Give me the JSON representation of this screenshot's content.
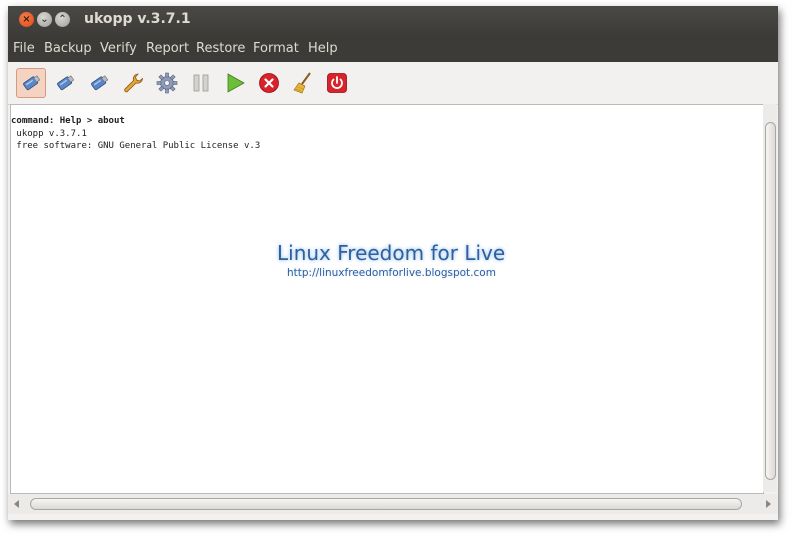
{
  "window": {
    "title": "ukopp v.3.7.1",
    "controls": {
      "close": "×",
      "minimize": "⌄",
      "maximize": "⌃"
    }
  },
  "menu": [
    "File",
    "Backup",
    "Verify",
    "Report",
    "Restore",
    "Format",
    "Help"
  ],
  "toolbar": [
    {
      "name": "usb-drive-mount-icon",
      "active": true
    },
    {
      "name": "usb-drive-icon-2"
    },
    {
      "name": "usb-drive-icon-3"
    },
    {
      "name": "wrench-icon"
    },
    {
      "name": "gear-icon"
    },
    {
      "name": "pause-icon"
    },
    {
      "name": "play-icon"
    },
    {
      "name": "stop-icon"
    },
    {
      "name": "broom-clear-icon"
    },
    {
      "name": "power-quit-icon"
    }
  ],
  "output": {
    "command_line": "command: Help > about",
    "lines": [
      " ukopp v.3.7.1",
      " free software: GNU General Public License v.3"
    ]
  },
  "watermark": {
    "title": "Linux Freedom for Live",
    "url": "http://linuxfreedomforlive.blogspot.com"
  },
  "colors": {
    "titlebar": "#3c3b37",
    "close_button": "#dd4814",
    "watermark": "#2e5f9e"
  }
}
